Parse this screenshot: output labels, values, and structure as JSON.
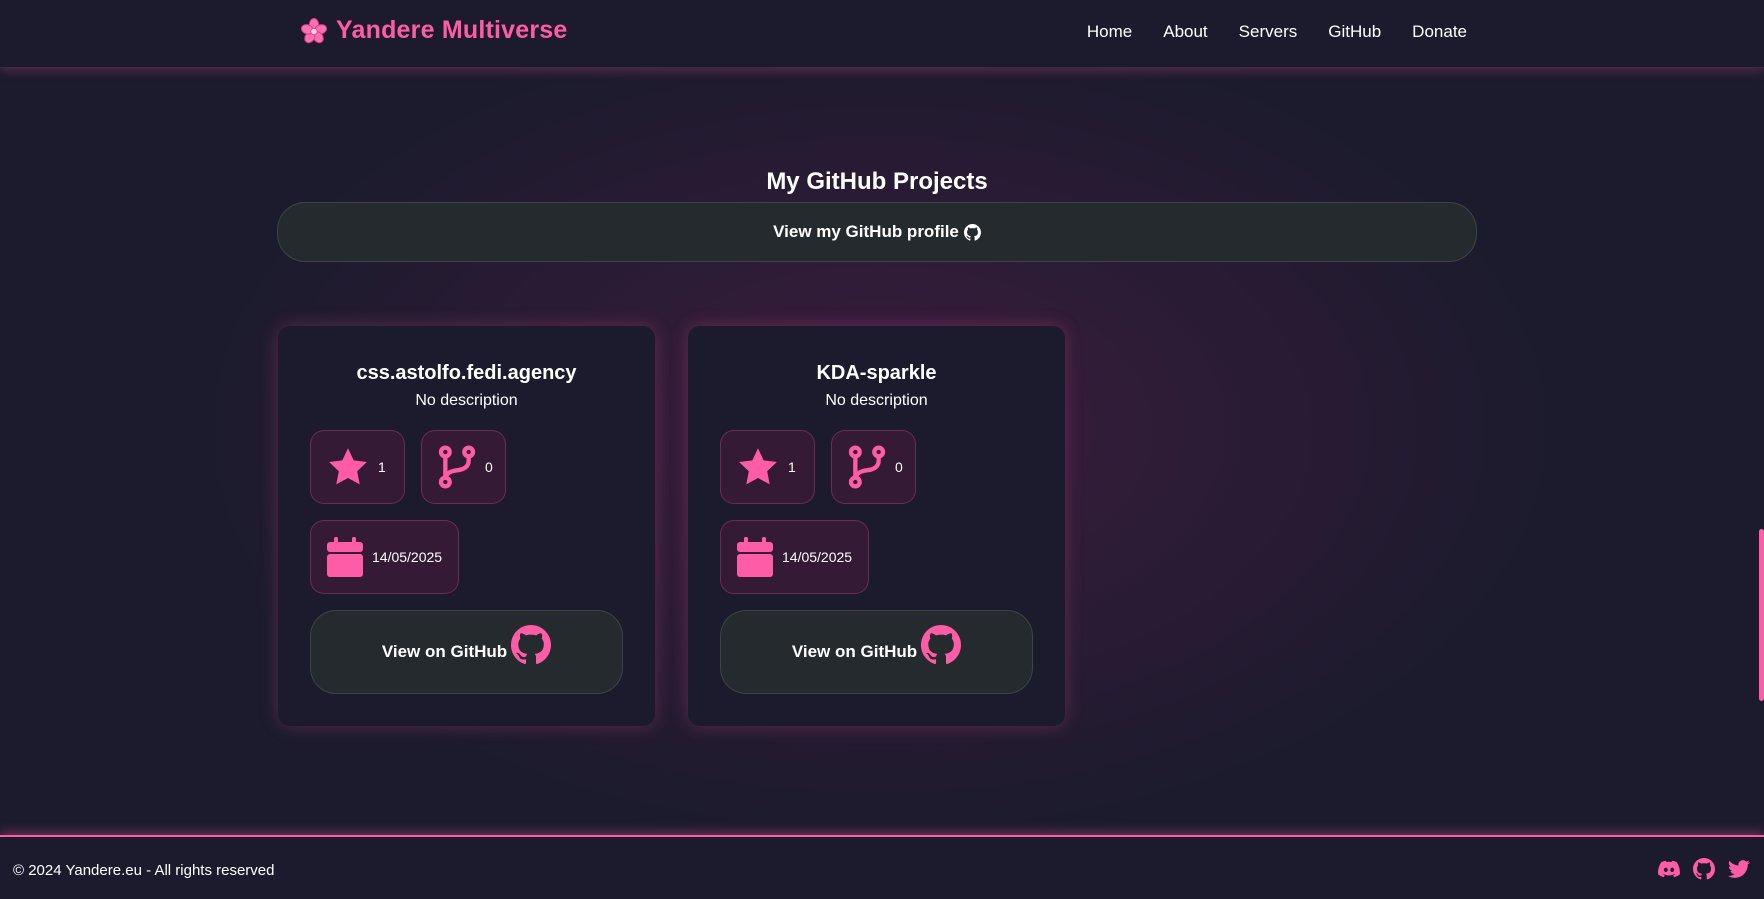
{
  "colors": {
    "accent": "#ff5ca8",
    "background": "#1b1b2d",
    "button_bg": "#252a2e"
  },
  "header": {
    "brand_icon": "sakura-flower-icon",
    "brand_name": "Yandere Multiverse",
    "nav": [
      "Home",
      "About",
      "Servers",
      "GitHub",
      "Donate"
    ]
  },
  "main": {
    "title": "My GitHub Projects",
    "profile_button": {
      "label": "View my GitHub profile",
      "icon": "github-icon"
    },
    "projects": [
      {
        "name": "css.astolfo.fedi.agency",
        "description": "No description",
        "stars": "1",
        "forks": "0",
        "updated": "14/05/2025",
        "button_label": "View on GitHub"
      },
      {
        "name": "KDA-sparkle",
        "description": "No description",
        "stars": "1",
        "forks": "0",
        "updated": "14/05/2025",
        "button_label": "View on GitHub"
      }
    ],
    "stat_icons": [
      "star-icon",
      "fork-icon",
      "calendar-icon"
    ]
  },
  "footer": {
    "copyright": "© 2024 Yandere.eu - All rights reserved",
    "social_icons": [
      "discord-icon",
      "github-icon",
      "twitter-icon"
    ]
  }
}
